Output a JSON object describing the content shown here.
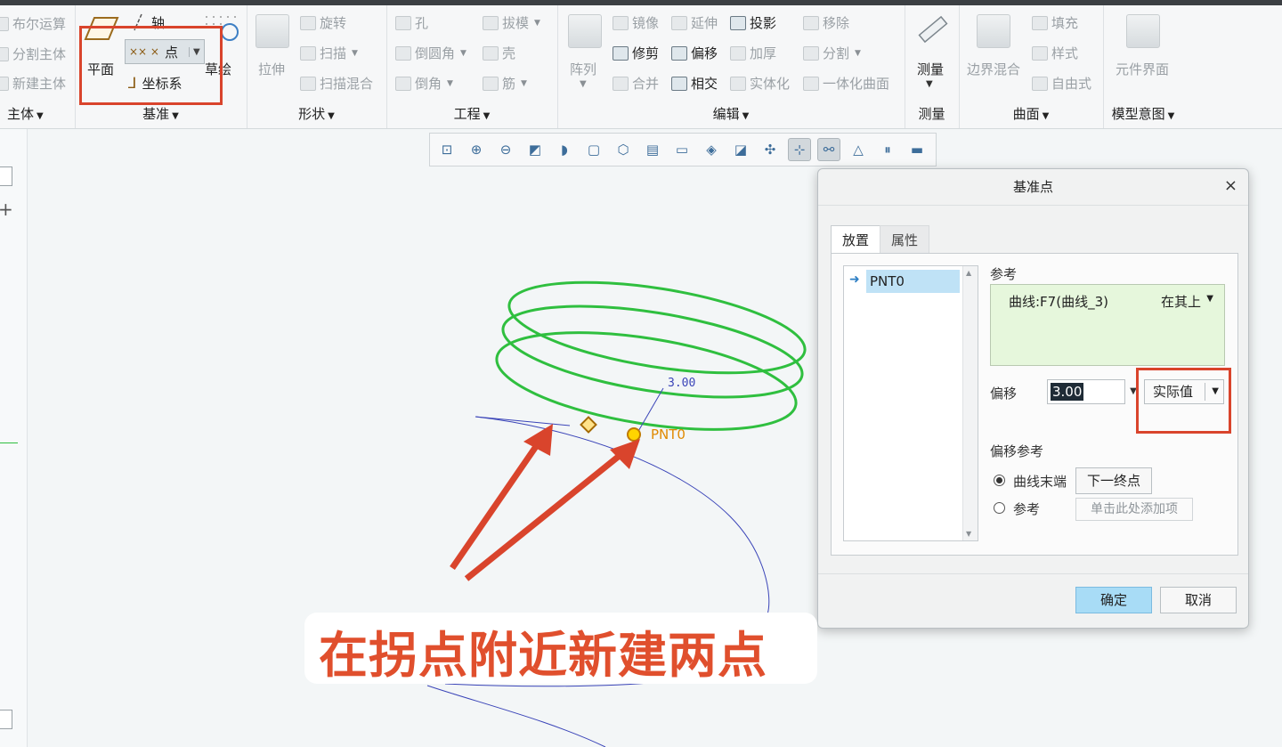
{
  "ribbon": {
    "body": {
      "items": [
        "布尔运算",
        "分割主体",
        "新建主体"
      ],
      "title": "主体"
    },
    "datum": {
      "plane": "平面",
      "axis": "轴",
      "point": "点",
      "csys": "坐标系",
      "sketch": "草绘",
      "title": "基准"
    },
    "shape": {
      "extrude": "拉伸",
      "revolve": "旋转",
      "sweep": "扫描",
      "swept_blend": "扫描混合",
      "title": "形状"
    },
    "engineering": {
      "hole": "孔",
      "round": "倒圆角",
      "chamfer": "倒角",
      "draft": "拔模",
      "shell": "壳",
      "rib": "筋",
      "title": "工程"
    },
    "editing": {
      "pattern": "阵列",
      "mirror": "镜像",
      "trim": "修剪",
      "merge": "合并",
      "extend": "延伸",
      "offset": "偏移",
      "intersect": "相交",
      "project": "投影",
      "thicken": "加厚",
      "solidify": "实体化",
      "remove": "移除",
      "split": "分割",
      "unify": "一体化曲面",
      "title": "编辑"
    },
    "measure": {
      "button": "测量",
      "title": "测量"
    },
    "surfaces": {
      "boundary_blend": "边界混合",
      "fill": "填充",
      "style": "样式",
      "freestyle": "自由式",
      "title": "曲面"
    },
    "model_intent": {
      "component_interface": "元件界面",
      "title": "模型意图"
    }
  },
  "viewport": {
    "dimension_label": "3.00",
    "point_label": "PNT0"
  },
  "dialog": {
    "title": "基准点",
    "tabs": [
      "放置",
      "属性"
    ],
    "list_item": "PNT0",
    "reference_label": "参考",
    "reference_entry": "曲线:F7(曲线_3)",
    "reference_type": "在其上",
    "offset_label": "偏移",
    "offset_value": "3.00",
    "offset_mode": "实际值",
    "offset_ref_label": "偏移参考",
    "radio_curve_end": "曲线末端",
    "next_end_button": "下一终点",
    "radio_reference": "参考",
    "add_item_placeholder": "单击此处添加项",
    "ok": "确定",
    "cancel": "取消"
  },
  "caption": "在拐点附近新建两点",
  "colors": {
    "annotation_red": "#d9442c",
    "helix_green": "#2fbf3f",
    "curve_blue": "#3a44b8",
    "caption_red": "#e04f2d"
  }
}
